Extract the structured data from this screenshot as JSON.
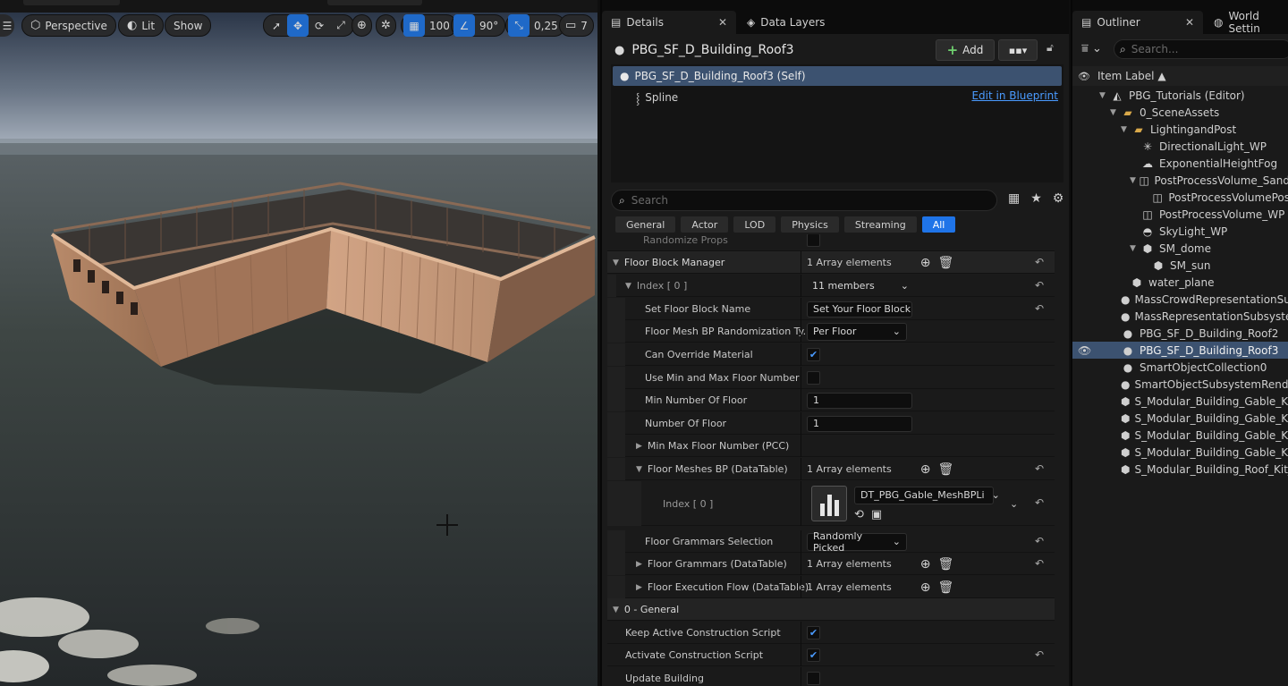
{
  "viewport": {
    "perspective": "Perspective",
    "lit": "Lit",
    "show": "Show",
    "grid_value": "100",
    "angle_value": "90°",
    "scale_value": "0,25",
    "camera_value": "7"
  },
  "details": {
    "tab_details": "Details",
    "tab_data_layers": "Data Layers",
    "actor_name": "PBG_SF_D_Building_Roof3",
    "add_label": "Add",
    "self_label": "PBG_SF_D_Building_Roof3 (Self)",
    "spline_label": "Spline",
    "edit_in_blueprint": "Edit in Blueprint",
    "search_placeholder": "Search",
    "filters": [
      "General",
      "Actor",
      "LOD",
      "Physics",
      "Streaming",
      "All"
    ],
    "rows": {
      "randomize_props": "Randomize Props",
      "floor_block_manager": "Floor Block Manager",
      "floor_block_manager_val": "1 Array elements",
      "index0": "Index [ 0 ]",
      "index0_val": "11 members",
      "set_floor_block_name": "Set Floor Block Name",
      "set_floor_block_name_val": "Set Your Floor Block",
      "floor_mesh_random": "Floor Mesh BP Randomization Ty...",
      "floor_mesh_random_val": "Per Floor",
      "can_override": "Can Override Material",
      "use_min_max": "Use Min and Max Floor Number",
      "min_number": "Min Number Of Floor",
      "min_number_val": "1",
      "number_of_floor": "Number Of Floor",
      "number_of_floor_val": "1",
      "min_max_pcc": "Min Max Floor Number (PCC)",
      "floor_meshes_bp": "Floor Meshes BP (DataTable)",
      "floor_meshes_bp_val": "1 Array elements",
      "index0_sub": "Index [ 0 ]",
      "asset_name": "DT_PBG_Gable_MeshBPLi",
      "floor_grammars_sel": "Floor Grammars Selection",
      "floor_grammars_sel_val": "Randomly Picked",
      "floor_grammars_dt": "Floor Grammars (DataTable)",
      "floor_grammars_dt_val": "1 Array elements",
      "floor_exec_flow": "Floor Execution Flow (DataTable)",
      "floor_exec_flow_val": "1 Array elements",
      "general_section": "0 - General",
      "keep_active": "Keep Active Construction Script",
      "activate_cs": "Activate Construction Script",
      "update_building": "Update Building"
    }
  },
  "outliner": {
    "tab_outliner": "Outliner",
    "tab_world": "World Settin",
    "search_placeholder": "Search...",
    "column": "Item Label ▲",
    "items": [
      {
        "label": "PBG_Tutorials (Editor)",
        "icon": "level-icon"
      },
      {
        "label": "0_SceneAssets",
        "icon": "folder-icon"
      },
      {
        "label": "LightingandPost",
        "icon": "folder-icon"
      },
      {
        "label": "DirectionalLight_WP",
        "icon": "sun-icon"
      },
      {
        "label": "ExponentialHeightFog",
        "icon": "fog-icon"
      },
      {
        "label": "PostProcessVolume_Sand",
        "icon": "volume-icon"
      },
      {
        "label": "PostProcessVolumePos",
        "icon": "volume-icon"
      },
      {
        "label": "PostProcessVolume_WP",
        "icon": "volume-icon"
      },
      {
        "label": "SkyLight_WP",
        "icon": "skylight-icon"
      },
      {
        "label": "SM_dome",
        "icon": "mesh-icon"
      },
      {
        "label": "SM_sun",
        "icon": "mesh-icon"
      },
      {
        "label": "water_plane",
        "icon": "mesh-icon"
      },
      {
        "label": "MassCrowdRepresentationSub",
        "icon": "actor-icon"
      },
      {
        "label": "MassRepresentationSubsyster",
        "icon": "actor-icon"
      },
      {
        "label": "PBG_SF_D_Building_Roof2",
        "icon": "actor-icon"
      },
      {
        "label": "PBG_SF_D_Building_Roof3",
        "icon": "actor-icon"
      },
      {
        "label": "SmartObjectCollection0",
        "icon": "actor-icon"
      },
      {
        "label": "SmartObjectSubsystemRender",
        "icon": "actor-icon"
      },
      {
        "label": "S_Modular_Building_Gable_Kit_",
        "icon": "mesh-icon"
      },
      {
        "label": "S_Modular_Building_Gable_Kit_",
        "icon": "mesh-icon"
      },
      {
        "label": "S_Modular_Building_Gable_Kit_",
        "icon": "mesh-icon"
      },
      {
        "label": "S_Modular_Building_Gable_Kit_",
        "icon": "mesh-icon"
      },
      {
        "label": "S_Modular_Building_Roof_Kit_v",
        "icon": "mesh-icon"
      }
    ]
  }
}
